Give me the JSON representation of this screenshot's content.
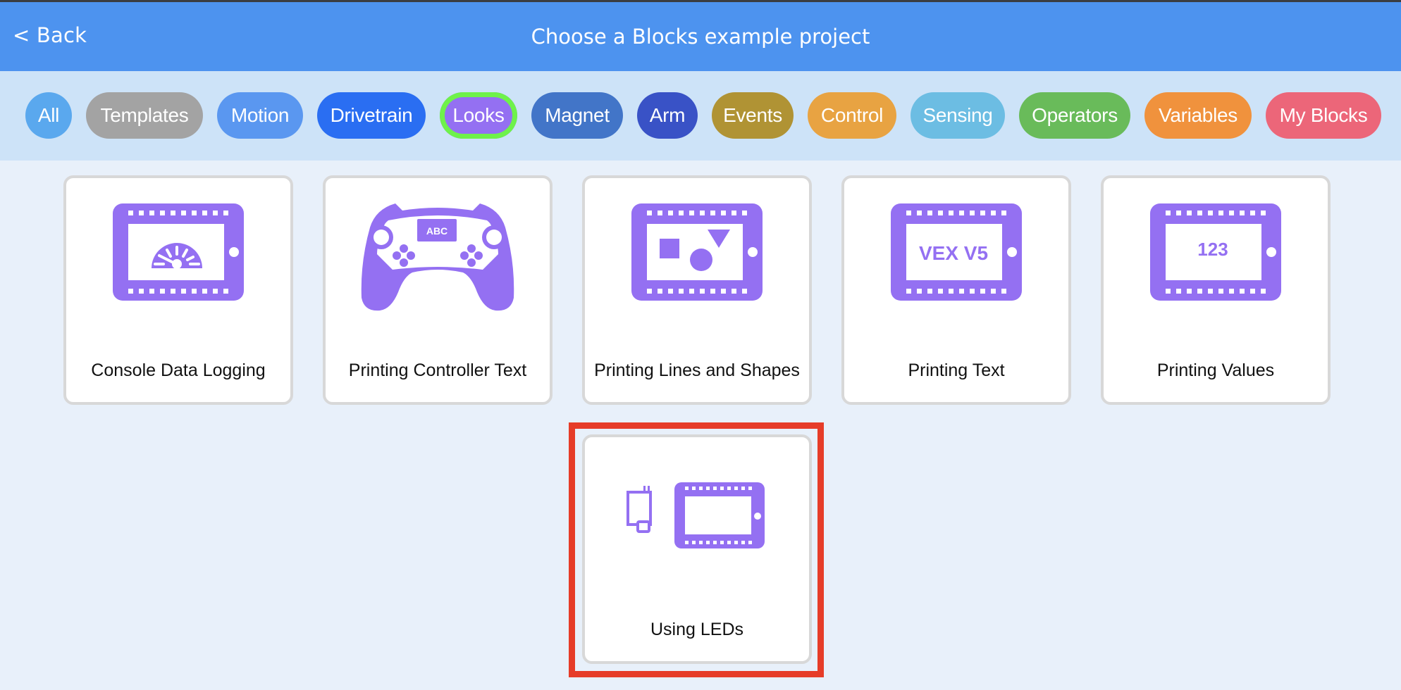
{
  "header": {
    "back_label": "< Back",
    "title": "Choose a Blocks example project",
    "color": "#4d93ef"
  },
  "filters": {
    "selected": "Looks",
    "items": [
      {
        "label": "All",
        "color": "#5aa8ee"
      },
      {
        "label": "Templates",
        "color": "#a3a3a3"
      },
      {
        "label": "Motion",
        "color": "#5a97f0"
      },
      {
        "label": "Drivetrain",
        "color": "#2a6ef2"
      },
      {
        "label": "Looks",
        "color": "#9470f2",
        "selected": true,
        "outline": "#6ef24a"
      },
      {
        "label": "Magnet",
        "color": "#4275c8"
      },
      {
        "label": "Arm",
        "color": "#3952c6"
      },
      {
        "label": "Events",
        "color": "#b09334"
      },
      {
        "label": "Control",
        "color": "#e8a342"
      },
      {
        "label": "Sensing",
        "color": "#6cbde3"
      },
      {
        "label": "Operators",
        "color": "#69bb5a"
      },
      {
        "label": "Variables",
        "color": "#f0923d"
      },
      {
        "label": "My Blocks",
        "color": "#ec6679"
      }
    ]
  },
  "projects": [
    {
      "label": "Console Data Logging",
      "icon": "brain-screen-gauge-icon"
    },
    {
      "label": "Printing Controller Text",
      "icon": "controller-abc-icon",
      "icon_text": "ABC"
    },
    {
      "label": "Printing Lines and Shapes",
      "icon": "brain-screen-shapes-icon"
    },
    {
      "label": "Printing Text",
      "icon": "brain-screen-text-icon",
      "icon_text": "VEX V5"
    },
    {
      "label": "Printing Values",
      "icon": "brain-screen-values-icon",
      "icon_text": "123"
    },
    {
      "label": "Using LEDs",
      "icon": "led-and-brain-screen-icon",
      "highlighted": true
    }
  ],
  "icon_color": "#9470f2",
  "highlight_color": "#e63c28"
}
